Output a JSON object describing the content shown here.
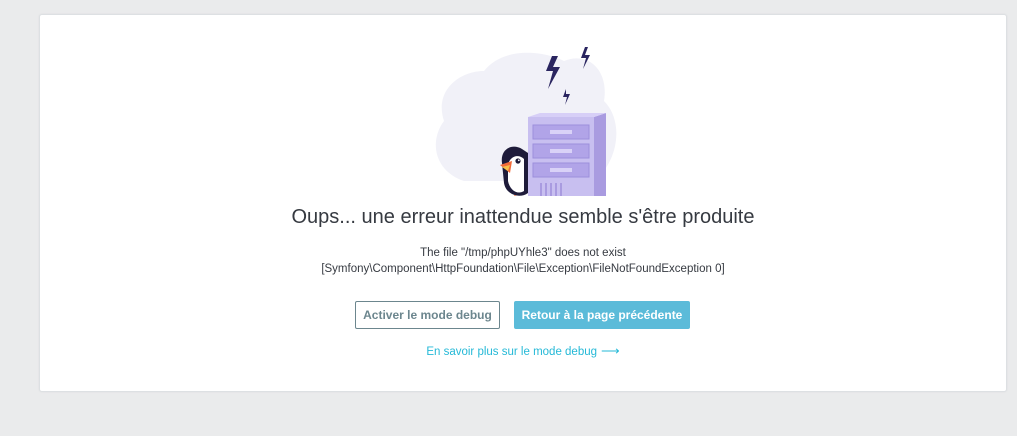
{
  "error": {
    "title": "Oups... une erreur inattendue semble s'être produite",
    "message_line1": "The file \"/tmp/phpUYhle3\" does not exist",
    "message_line2": "[Symfony\\Component\\HttpFoundation\\File\\Exception\\FileNotFoundException 0]"
  },
  "actions": {
    "debug_button": "Activer le mode debug",
    "back_button": "Retour à la page précédente",
    "learn_more_link": "En savoir plus sur le mode debug",
    "learn_more_arrow": "⟶"
  },
  "illustration": {
    "icon": "server-error-illustration",
    "accent": "#5bbbd9",
    "server_color": "#c8bff0",
    "blob_color": "#f1f1f8"
  }
}
